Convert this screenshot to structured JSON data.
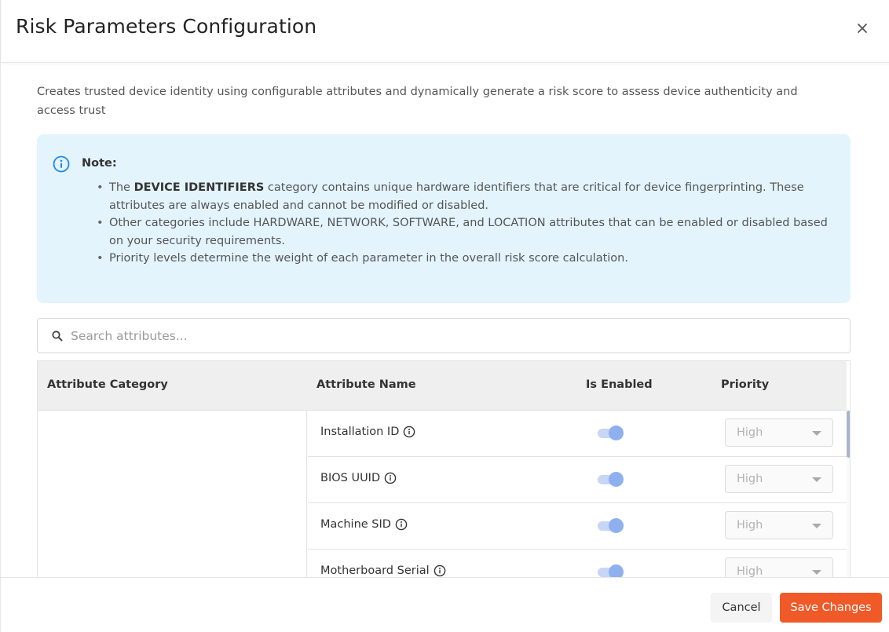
{
  "modal": {
    "title": "Risk Parameters Configuration",
    "close_icon": "close-icon",
    "description": "Creates trusted device identity using configurable attributes and dynamically generate a risk score to assess device authenticity and access trust"
  },
  "note": {
    "icon": "info-circle-icon",
    "title": "Note:",
    "items": [
      {
        "prefix": "The ",
        "bold": "DEVICE IDENTIFIERS",
        "suffix": " category contains unique hardware identifiers that are critical for device fingerprinting. These attributes are always enabled and cannot be modified or disabled."
      },
      {
        "text": "Other categories include HARDWARE, NETWORK, SOFTWARE, and LOCATION attributes that can be enabled or disabled based on your security requirements."
      },
      {
        "text": "Priority levels determine the weight of each parameter in the overall risk score calculation."
      }
    ],
    "background_color": "#e3f4fd"
  },
  "search": {
    "icon": "search-icon",
    "placeholder": "Search attributes...",
    "value": ""
  },
  "table": {
    "headers": {
      "category": "Attribute Category",
      "name": "Attribute Name",
      "enabled": "Is Enabled",
      "priority": "Priority"
    },
    "category_value": "",
    "rows": [
      {
        "name": "Installation ID",
        "enabled": true,
        "disabled": true,
        "priority": "High"
      },
      {
        "name": "BIOS UUID",
        "enabled": true,
        "disabled": true,
        "priority": "High"
      },
      {
        "name": "Machine SID",
        "enabled": true,
        "disabled": true,
        "priority": "High"
      },
      {
        "name": "Motherboard Serial",
        "enabled": true,
        "disabled": true,
        "priority": "High"
      }
    ]
  },
  "footer": {
    "cancel_label": "Cancel",
    "save_label": "Save Changes"
  },
  "colors": {
    "accent": "#f05a28",
    "toggle_knob": "#8fb0ee",
    "toggle_track": "#c6d6f4",
    "info_icon": "#1e88e5"
  }
}
